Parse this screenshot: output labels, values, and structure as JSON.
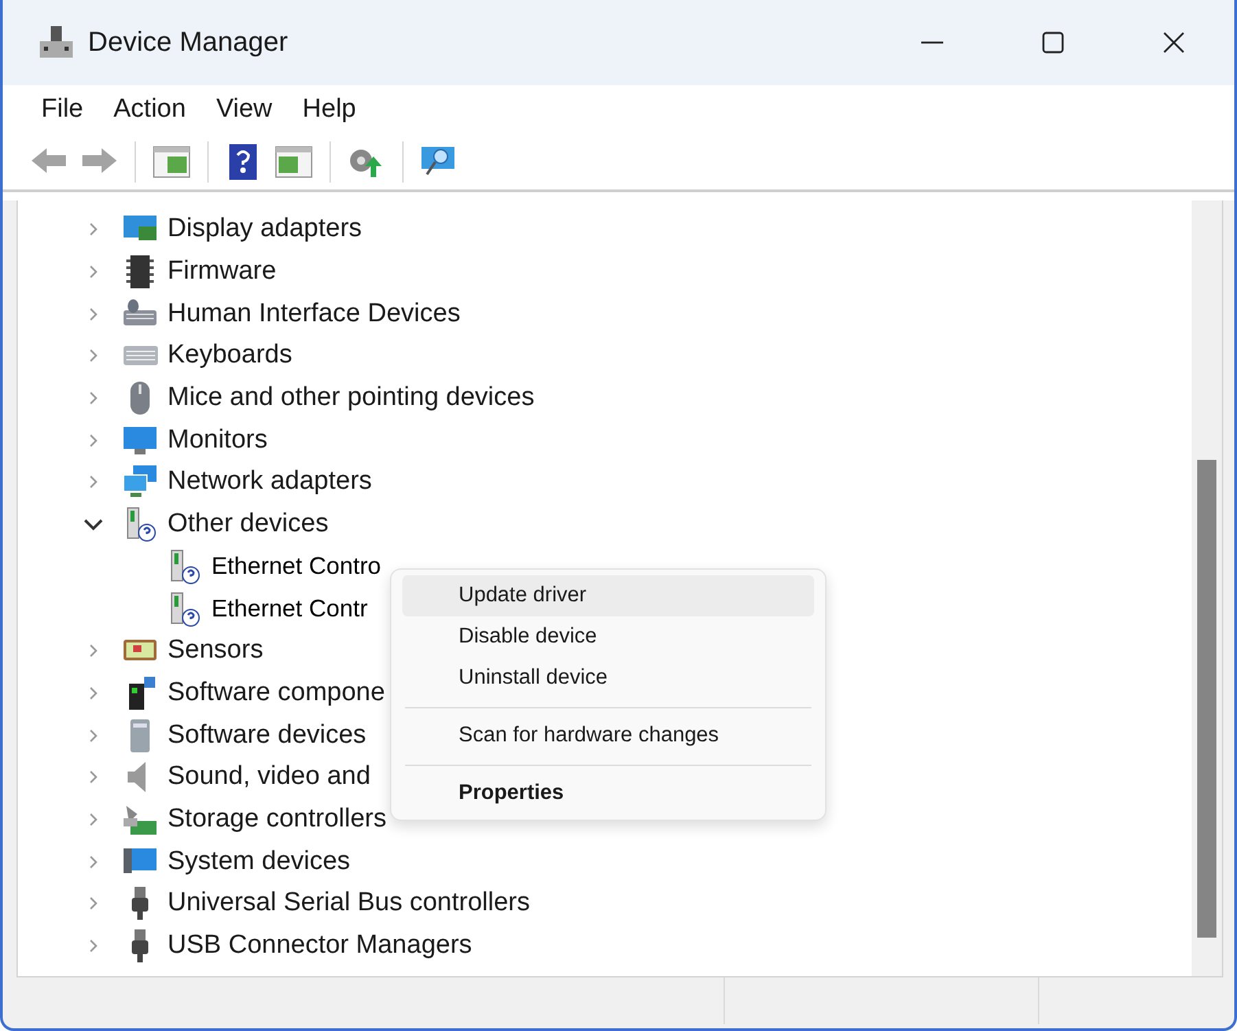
{
  "window": {
    "title": "Device Manager"
  },
  "menu_bar": [
    {
      "label": "File"
    },
    {
      "label": "Action"
    },
    {
      "label": "View"
    },
    {
      "label": "Help"
    }
  ],
  "toolbar": [
    {
      "kind": "back",
      "disabled": true
    },
    {
      "kind": "forward",
      "disabled": true
    },
    {
      "kind": "separator"
    },
    {
      "kind": "pane-left",
      "disabled": false
    },
    {
      "kind": "separator"
    },
    {
      "kind": "help",
      "disabled": false
    },
    {
      "kind": "pane-right",
      "disabled": false
    },
    {
      "kind": "separator"
    },
    {
      "kind": "update",
      "disabled": false
    },
    {
      "kind": "separator"
    },
    {
      "kind": "scan",
      "disabled": false
    }
  ],
  "tree": [
    {
      "label": "Display adapters",
      "expanded": false
    },
    {
      "label": "Firmware",
      "expanded": false
    },
    {
      "label": "Human Interface Devices",
      "expanded": false
    },
    {
      "label": "Keyboards",
      "expanded": false
    },
    {
      "label": "Mice and other pointing devices",
      "expanded": false
    },
    {
      "label": "Monitors",
      "expanded": false
    },
    {
      "label": "Network adapters",
      "expanded": false
    },
    {
      "label": "Other devices",
      "expanded": true,
      "children": [
        {
          "label": "Ethernet Contro"
        },
        {
          "label": "Ethernet Contr"
        }
      ]
    },
    {
      "label": "Sensors",
      "expanded": false
    },
    {
      "label": "Software compone",
      "expanded": false
    },
    {
      "label": "Software devices",
      "expanded": false
    },
    {
      "label": "Sound, video and",
      "expanded": false
    },
    {
      "label": "Storage controllers",
      "expanded": false
    },
    {
      "label": "System devices",
      "expanded": false
    },
    {
      "label": "Universal Serial Bus controllers",
      "expanded": false
    },
    {
      "label": "USB Connector Managers",
      "expanded": false
    }
  ],
  "context_menu": [
    {
      "kind": "item",
      "label": "Update driver",
      "selected": true,
      "default": false
    },
    {
      "kind": "item",
      "label": "Disable device",
      "selected": false,
      "default": false
    },
    {
      "kind": "item",
      "label": "Uninstall device",
      "selected": false,
      "default": false
    },
    {
      "kind": "separator"
    },
    {
      "kind": "item",
      "label": "Scan for hardware changes",
      "selected": false,
      "default": false
    },
    {
      "kind": "separator"
    },
    {
      "kind": "item",
      "label": "Properties",
      "selected": false,
      "default": true
    }
  ]
}
